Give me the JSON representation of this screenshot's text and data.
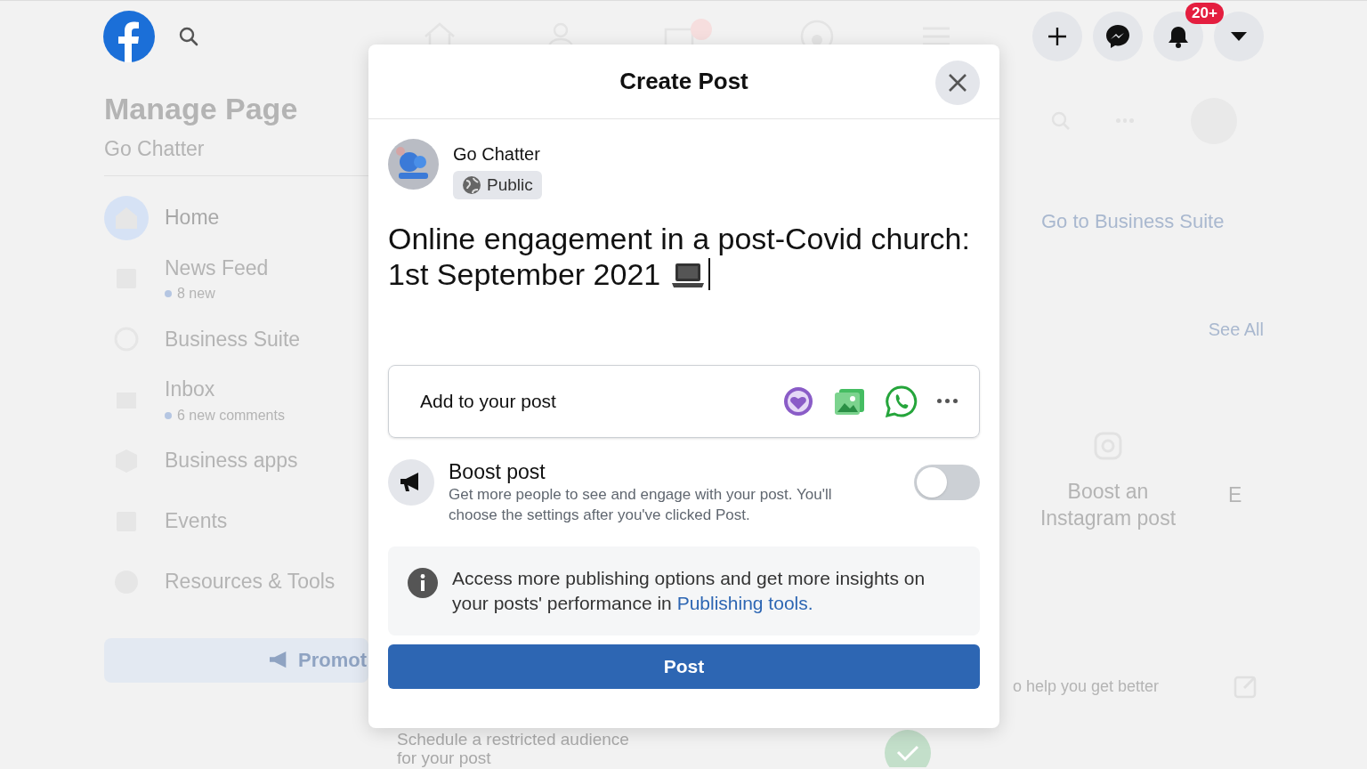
{
  "top_bar": {
    "notification_badge": "20+"
  },
  "sidebar": {
    "title": "Manage Page",
    "page_name": "Go Chatter",
    "items": [
      {
        "label": "Home",
        "selected": true
      },
      {
        "label": "News Feed",
        "subtitle": "8 new",
        "selected": false
      },
      {
        "label": "Business Suite",
        "selected": false
      },
      {
        "label": "Inbox",
        "subtitle": "6 new comments",
        "selected": false
      },
      {
        "label": "Business apps",
        "selected": false
      },
      {
        "label": "Events",
        "selected": false
      },
      {
        "label": "Resources & Tools",
        "selected": false
      }
    ],
    "promote_button": "Promot"
  },
  "right_panel": {
    "business_suite_button": "Go to Business Suite",
    "see_all": "See All",
    "cards": [
      {
        "title": "Boost an Instagram post"
      },
      {
        "title": "E"
      }
    ],
    "tip": "o help you get better"
  },
  "behind_dialog": {
    "lines": [
      "Schedule a restricted audience",
      "for your post"
    ]
  },
  "dialog": {
    "title": "Create Post",
    "author": "Go Chatter",
    "audience": "Public",
    "post_text": "Online engagement in a post-Covid church: 1st September 2021",
    "add_to_post": "Add to your post",
    "boost": {
      "title": "Boost post",
      "description": "Get more people to see and engage with your post. You'll choose the settings after you've clicked Post.",
      "on": false
    },
    "info": {
      "text": "Access more publishing options and get more insights on your posts' performance in",
      "link": "Publishing tools."
    },
    "post_button": "Post"
  }
}
